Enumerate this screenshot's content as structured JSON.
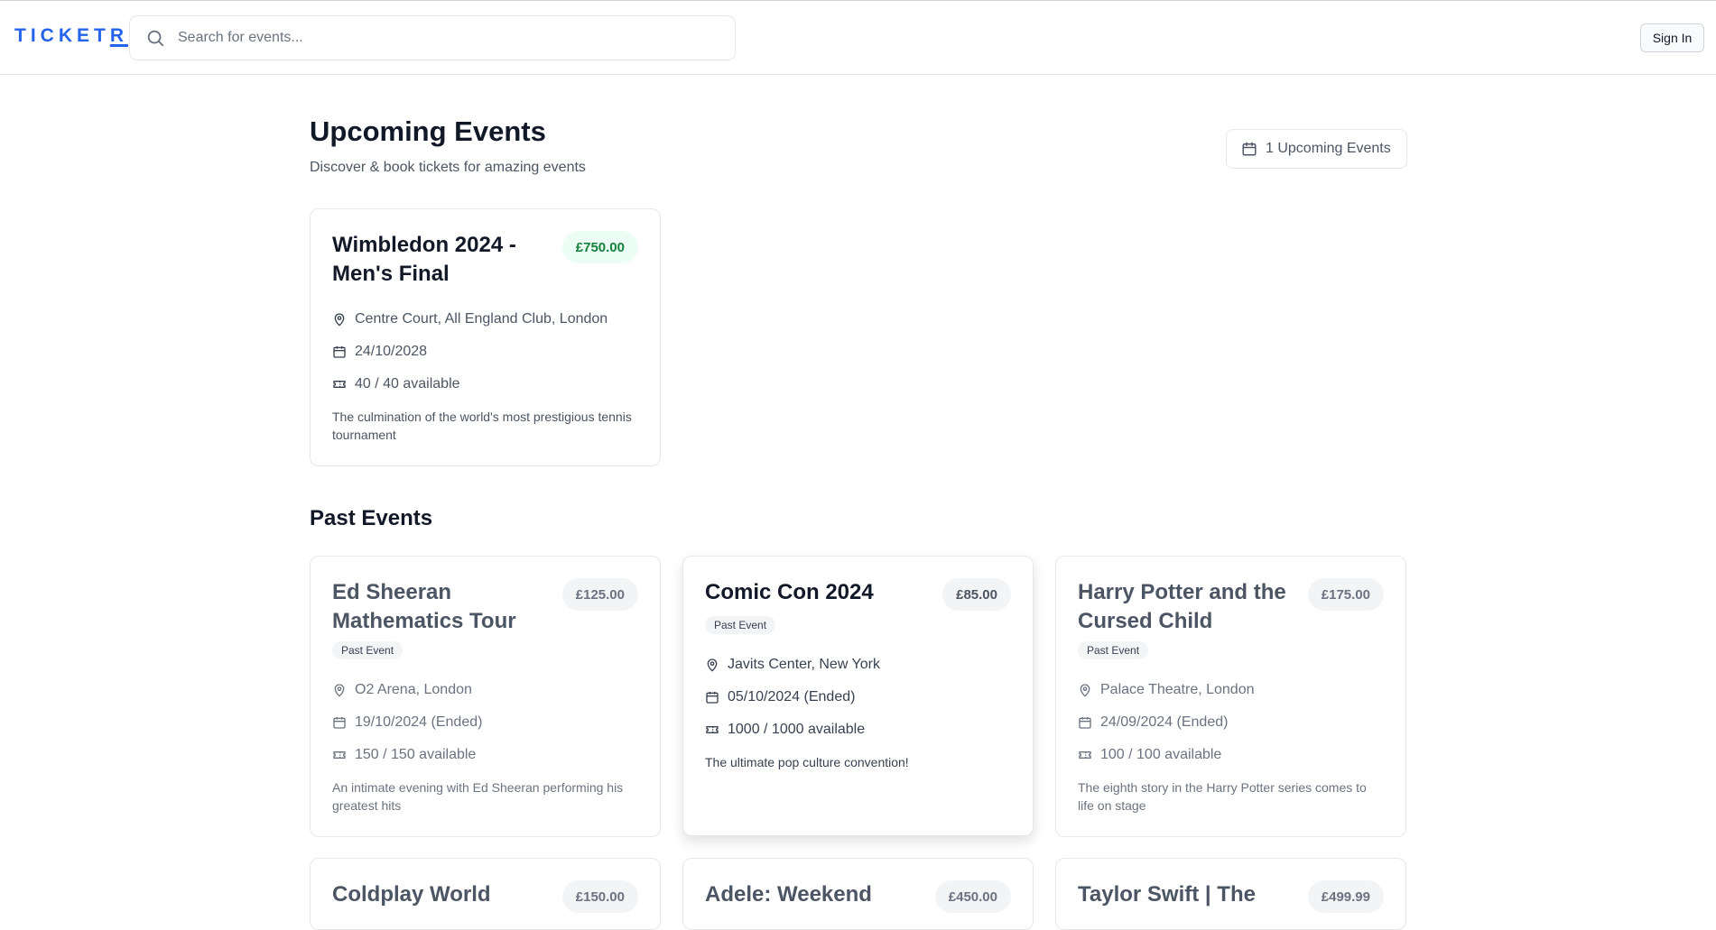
{
  "header": {
    "logo": "TICKETR",
    "search_placeholder": "Search for events...",
    "sign_in_label": "Sign In"
  },
  "upcoming": {
    "title": "Upcoming Events",
    "subtitle": "Discover & book tickets for amazing events",
    "count_label": "1 Upcoming Events",
    "events": [
      {
        "title": "Wimbledon 2024 - Men's Final",
        "price": "£750.00",
        "location": "Centre Court, All England Club, London",
        "date": "24/10/2028",
        "availability": "40 / 40 available",
        "description": "The culmination of the world's most prestigious tennis tournament"
      }
    ]
  },
  "past": {
    "title": "Past Events",
    "badge_label": "Past Event",
    "events": [
      {
        "title": "Ed Sheeran Mathematics Tour",
        "price": "£125.00",
        "location": "O2 Arena, London",
        "date": "19/10/2024 (Ended)",
        "availability": "150 / 150 available",
        "description": "An intimate evening with Ed Sheeran performing his greatest hits"
      },
      {
        "title": "Comic Con 2024",
        "price": "£85.00",
        "location": "Javits Center, New York",
        "date": "05/10/2024 (Ended)",
        "availability": "1000 / 1000 available",
        "description": "The ultimate pop culture convention!"
      },
      {
        "title": "Harry Potter and the Cursed Child",
        "price": "£175.00",
        "location": "Palace Theatre, London",
        "date": "24/09/2024 (Ended)",
        "availability": "100 / 100 available",
        "description": "The eighth story in the Harry Potter series comes to life on stage"
      },
      {
        "title": "Coldplay World",
        "price": "£150.00"
      },
      {
        "title": "Adele: Weekend",
        "price": "£450.00"
      },
      {
        "title": "Taylor Swift | The",
        "price": "£499.99"
      }
    ]
  },
  "icons": {
    "search": "search-icon",
    "calendar": "calendar-icon",
    "location": "map-pin-icon",
    "ticket": "ticket-icon"
  },
  "colors": {
    "brand": "#2563eb",
    "price_upcoming_bg": "#ecfdf5",
    "price_upcoming_text": "#15803d",
    "price_past_bg": "#f3f4f6",
    "price_past_text": "#6b7280"
  }
}
